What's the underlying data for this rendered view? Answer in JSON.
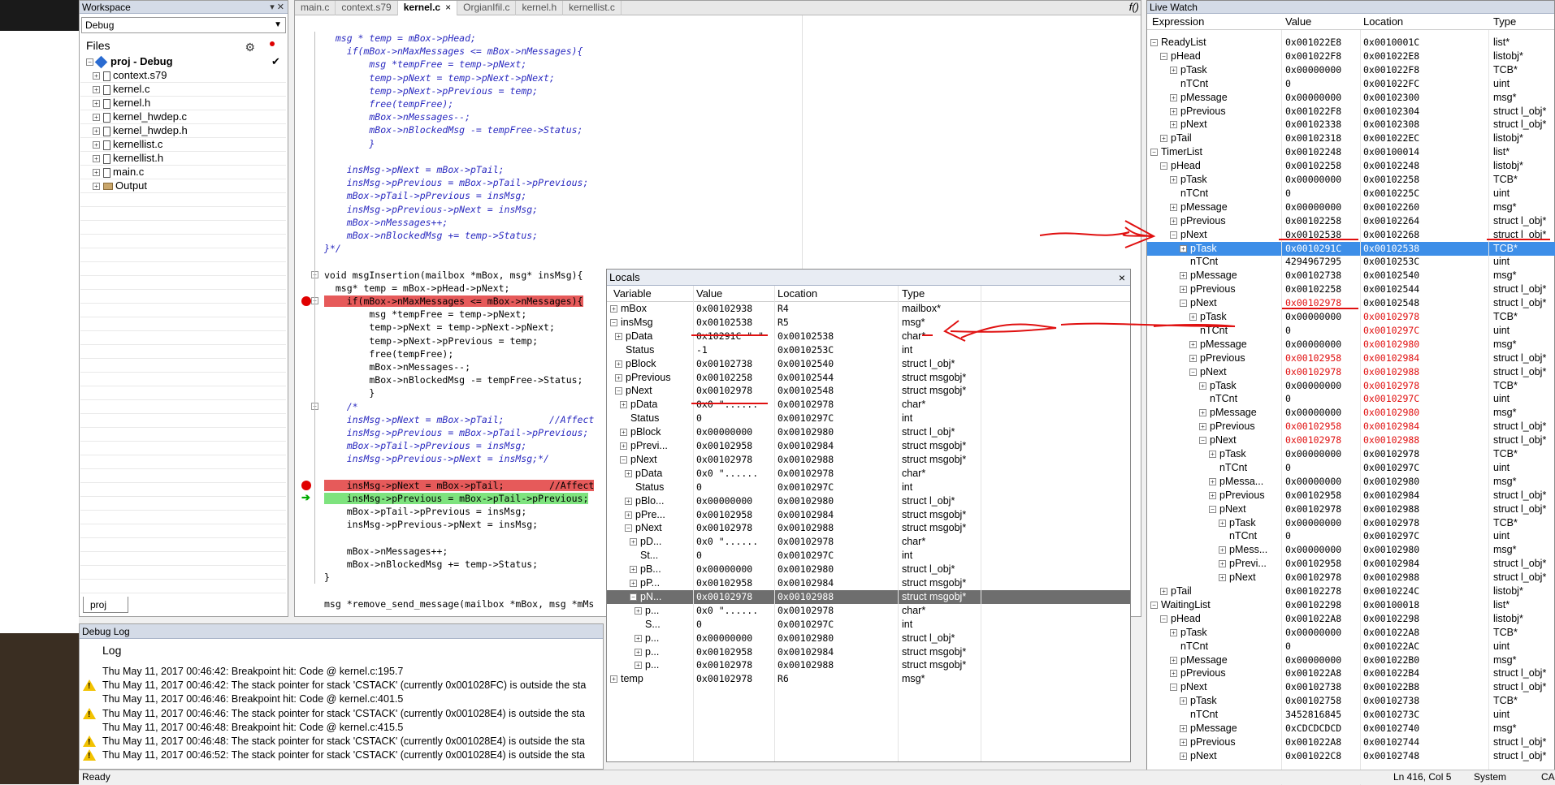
{
  "workspace": {
    "title": "Workspace",
    "config": "Debug",
    "files_label": "Files",
    "project": "proj - Debug",
    "files": [
      {
        "name": "context.s79",
        "expand": "+"
      },
      {
        "name": "kernel.c",
        "expand": "+"
      },
      {
        "name": "kernel.h",
        "expand": "+"
      },
      {
        "name": "kernel_hwdep.c",
        "expand": "+"
      },
      {
        "name": "kernel_hwdep.h",
        "expand": "+"
      },
      {
        "name": "kernellist.c",
        "expand": "+"
      },
      {
        "name": "kernellist.h",
        "expand": "+"
      },
      {
        "name": "main.c",
        "expand": "+"
      },
      {
        "name": "Output",
        "expand": "+"
      }
    ],
    "tab": "proj"
  },
  "editor": {
    "tabs": [
      "main.c",
      "context.s79",
      "kernel.c",
      "OrgianIfil.c",
      "kernel.h",
      "kernellist.c"
    ],
    "active_tab": "kernel.c",
    "tab_close": "×",
    "fx": "f()",
    "lines": [
      {
        "t": "  msg * temp = mBox->pHead;",
        "c": "cm"
      },
      {
        "t": "    if(mBox->nMaxMessages <= mBox->nMessages){",
        "c": "cm"
      },
      {
        "t": "        msg *tempFree = temp->pNext;",
        "c": "cm"
      },
      {
        "t": "        temp->pNext = temp->pNext->pNext;",
        "c": "cm"
      },
      {
        "t": "        temp->pNext->pPrevious = temp;",
        "c": "cm"
      },
      {
        "t": "        free(tempFree);",
        "c": "cm"
      },
      {
        "t": "        mBox->nMessages--;",
        "c": "cm"
      },
      {
        "t": "        mBox->nBlockedMsg -= tempFree->Status;",
        "c": "cm"
      },
      {
        "t": "        }",
        "c": "cm"
      },
      {
        "t": "",
        "c": ""
      },
      {
        "t": "    insMsg->pNext = mBox->pTail;",
        "c": "cm"
      },
      {
        "t": "    insMsg->pPrevious = mBox->pTail->pPrevious;",
        "c": "cm"
      },
      {
        "t": "    mBox->pTail->pPrevious = insMsg;",
        "c": "cm"
      },
      {
        "t": "    insMsg->pPrevious->pNext = insMsg;",
        "c": "cm"
      },
      {
        "t": "    mBox->nMessages++;",
        "c": "cm"
      },
      {
        "t": "    mBox->nBlockedMsg += temp->Status;",
        "c": "cm"
      },
      {
        "t": "}*/",
        "c": "cm"
      },
      {
        "t": "",
        "c": ""
      },
      {
        "t": "void msgInsertion(mailbox *mBox, msg* insMsg){",
        "c": ""
      },
      {
        "t": "  msg* temp = mBox->pHead->pNext;",
        "c": ""
      },
      {
        "t": "    if(mBox->nMaxMessages <= mBox->nMessages){",
        "c": "",
        "hl": "red"
      },
      {
        "t": "        msg *tempFree = temp->pNext;",
        "c": ""
      },
      {
        "t": "        temp->pNext = temp->pNext->pNext;",
        "c": ""
      },
      {
        "t": "        temp->pNext->pPrevious = temp;",
        "c": ""
      },
      {
        "t": "        free(tempFree);",
        "c": ""
      },
      {
        "t": "        mBox->nMessages--;",
        "c": ""
      },
      {
        "t": "        mBox->nBlockedMsg -= tempFree->Status;",
        "c": ""
      },
      {
        "t": "        }",
        "c": ""
      },
      {
        "t": "    /*",
        "c": "cm"
      },
      {
        "t": "    insMsg->pNext = mBox->pTail;        //Affect",
        "c": "cm"
      },
      {
        "t": "    insMsg->pPrevious = mBox->pTail->pPrevious;",
        "c": "cm"
      },
      {
        "t": "    mBox->pTail->pPrevious = insMsg;",
        "c": "cm"
      },
      {
        "t": "    insMsg->pPrevious->pNext = insMsg;*/",
        "c": "cm"
      },
      {
        "t": "",
        "c": ""
      },
      {
        "t": "    insMsg->pNext = mBox->pTail;        //Affect",
        "c": "",
        "hl": "red"
      },
      {
        "t": "    insMsg->pPrevious = mBox->pTail->pPrevious;",
        "c": "",
        "hl": "green"
      },
      {
        "t": "    mBox->pTail->pPrevious = insMsg;",
        "c": ""
      },
      {
        "t": "    insMsg->pPrevious->pNext = insMsg;",
        "c": ""
      },
      {
        "t": "",
        "c": ""
      },
      {
        "t": "    mBox->nMessages++;",
        "c": ""
      },
      {
        "t": "    mBox->nBlockedMsg += temp->Status;",
        "c": ""
      },
      {
        "t": "}",
        "c": ""
      },
      {
        "t": "",
        "c": ""
      },
      {
        "t": "msg *remove_send_message(mailbox *mBox, msg *mMs",
        "c": ""
      }
    ]
  },
  "locals": {
    "title": "Locals",
    "close": "×",
    "columns": [
      "Variable",
      "Value",
      "Location",
      "Type"
    ],
    "rows": [
      {
        "d": 0,
        "e": "+",
        "n": "mBox",
        "v": "0x00102938",
        "l": "R4",
        "t": "mailbox*"
      },
      {
        "d": 0,
        "e": "−",
        "n": "insMsg",
        "v": "0x00102538",
        "l": "R5",
        "t": "msg*"
      },
      {
        "d": 1,
        "e": "+",
        "n": "pData",
        "v": "0x10291C \" \"",
        "l": "0x00102538",
        "t": "char*"
      },
      {
        "d": 1,
        "e": "",
        "n": "Status",
        "v": "-1",
        "l": "0x0010253C",
        "t": "int"
      },
      {
        "d": 1,
        "e": "+",
        "n": "pBlock",
        "v": "0x00102738",
        "l": "0x00102540",
        "t": "struct l_obj*"
      },
      {
        "d": 1,
        "e": "+",
        "n": "pPrevious",
        "v": "0x00102258",
        "l": "0x00102544",
        "t": "struct msgobj*"
      },
      {
        "d": 1,
        "e": "−",
        "n": "pNext",
        "v": "0x00102978",
        "l": "0x00102548",
        "t": "struct msgobj*"
      },
      {
        "d": 2,
        "e": "+",
        "n": "pData",
        "v": "0x0 \"......",
        "l": "0x00102978",
        "t": "char*"
      },
      {
        "d": 2,
        "e": "",
        "n": "Status",
        "v": "0",
        "l": "0x0010297C",
        "t": "int"
      },
      {
        "d": 2,
        "e": "+",
        "n": "pBlock",
        "v": "0x00000000",
        "l": "0x00102980",
        "t": "struct l_obj*"
      },
      {
        "d": 2,
        "e": "+",
        "n": "pPrevi...",
        "v": "0x00102958",
        "l": "0x00102984",
        "t": "struct msgobj*"
      },
      {
        "d": 2,
        "e": "−",
        "n": "pNext",
        "v": "0x00102978",
        "l": "0x00102988",
        "t": "struct msgobj*"
      },
      {
        "d": 3,
        "e": "+",
        "n": "pData",
        "v": "0x0 \"......",
        "l": "0x00102978",
        "t": "char*"
      },
      {
        "d": 3,
        "e": "",
        "n": "Status",
        "v": "0",
        "l": "0x0010297C",
        "t": "int"
      },
      {
        "d": 3,
        "e": "+",
        "n": "pBlo...",
        "v": "0x00000000",
        "l": "0x00102980",
        "t": "struct l_obj*"
      },
      {
        "d": 3,
        "e": "+",
        "n": "pPre...",
        "v": "0x00102958",
        "l": "0x00102984",
        "t": "struct msgobj*"
      },
      {
        "d": 3,
        "e": "−",
        "n": "pNext",
        "v": "0x00102978",
        "l": "0x00102988",
        "t": "struct msgobj*"
      },
      {
        "d": 4,
        "e": "+",
        "n": "pD...",
        "v": "0x0 \"......",
        "l": "0x00102978",
        "t": "char*"
      },
      {
        "d": 4,
        "e": "",
        "n": "St...",
        "v": "0",
        "l": "0x0010297C",
        "t": "int"
      },
      {
        "d": 4,
        "e": "+",
        "n": "pB...",
        "v": "0x00000000",
        "l": "0x00102980",
        "t": "struct l_obj*"
      },
      {
        "d": 4,
        "e": "+",
        "n": "pP...",
        "v": "0x00102958",
        "l": "0x00102984",
        "t": "struct msgobj*"
      },
      {
        "d": 4,
        "e": "−",
        "n": "pN...",
        "v": "0x00102978",
        "l": "0x00102988",
        "t": "struct msgobj*",
        "sel": true
      },
      {
        "d": 5,
        "e": "+",
        "n": "p...",
        "v": "0x0 \"......",
        "l": "0x00102978",
        "t": "char*"
      },
      {
        "d": 5,
        "e": "",
        "n": "S...",
        "v": "0",
        "l": "0x0010297C",
        "t": "int"
      },
      {
        "d": 5,
        "e": "+",
        "n": "p...",
        "v": "0x00000000",
        "l": "0x00102980",
        "t": "struct l_obj*"
      },
      {
        "d": 5,
        "e": "+",
        "n": "p...",
        "v": "0x00102958",
        "l": "0x00102984",
        "t": "struct msgobj*"
      },
      {
        "d": 5,
        "e": "+",
        "n": "p...",
        "v": "0x00102978",
        "l": "0x00102988",
        "t": "struct msgobj*"
      },
      {
        "d": 0,
        "e": "+",
        "n": "temp",
        "v": "0x00102978",
        "l": "R6",
        "t": "msg*"
      }
    ]
  },
  "live_watch": {
    "title": "Live Watch",
    "columns": [
      "Expression",
      "Value",
      "Location",
      "Type"
    ],
    "rows": [
      {
        "d": 0,
        "e": "−",
        "n": "ReadyList",
        "v": "0x001022E8",
        "l": "0x0010001C",
        "t": "list*"
      },
      {
        "d": 1,
        "e": "−",
        "n": "pHead",
        "v": "0x001022F8",
        "l": "0x001022E8",
        "t": "listobj*"
      },
      {
        "d": 2,
        "e": "+",
        "n": "pTask",
        "v": "0x00000000",
        "l": "0x001022F8",
        "t": "TCB*"
      },
      {
        "d": 2,
        "e": "",
        "n": "nTCnt",
        "v": "0",
        "l": "0x001022FC",
        "t": "uint"
      },
      {
        "d": 2,
        "e": "+",
        "n": "pMessage",
        "v": "0x00000000",
        "l": "0x00102300",
        "t": "msg*"
      },
      {
        "d": 2,
        "e": "+",
        "n": "pPrevious",
        "v": "0x001022F8",
        "l": "0x00102304",
        "t": "struct l_obj*"
      },
      {
        "d": 2,
        "e": "+",
        "n": "pNext",
        "v": "0x00102338",
        "l": "0x00102308",
        "t": "struct l_obj*"
      },
      {
        "d": 1,
        "e": "+",
        "n": "pTail",
        "v": "0x00102318",
        "l": "0x001022EC",
        "t": "listobj*"
      },
      {
        "d": 0,
        "e": "−",
        "n": "TimerList",
        "v": "0x00102248",
        "l": "0x00100014",
        "t": "list*"
      },
      {
        "d": 1,
        "e": "−",
        "n": "pHead",
        "v": "0x00102258",
        "l": "0x00102248",
        "t": "listobj*"
      },
      {
        "d": 2,
        "e": "+",
        "n": "pTask",
        "v": "0x00000000",
        "l": "0x00102258",
        "t": "TCB*"
      },
      {
        "d": 2,
        "e": "",
        "n": "nTCnt",
        "v": "0",
        "l": "0x0010225C",
        "t": "uint"
      },
      {
        "d": 2,
        "e": "+",
        "n": "pMessage",
        "v": "0x00000000",
        "l": "0x00102260",
        "t": "msg*"
      },
      {
        "d": 2,
        "e": "+",
        "n": "pPrevious",
        "v": "0x00102258",
        "l": "0x00102264",
        "t": "struct l_obj*"
      },
      {
        "d": 2,
        "e": "−",
        "n": "pNext",
        "v": "0x00102538",
        "l": "0x00102268",
        "t": "struct l_obj*"
      },
      {
        "d": 3,
        "e": "+",
        "n": "pTask",
        "v": "0x0010291C",
        "l": "0x00102538",
        "t": "TCB*",
        "sel": true
      },
      {
        "d": 3,
        "e": "",
        "n": "nTCnt",
        "v": "4294967295",
        "l": "0x0010253C",
        "t": "uint"
      },
      {
        "d": 3,
        "e": "+",
        "n": "pMessage",
        "v": "0x00102738",
        "l": "0x00102540",
        "t": "msg*"
      },
      {
        "d": 3,
        "e": "+",
        "n": "pPrevious",
        "v": "0x00102258",
        "l": "0x00102544",
        "t": "struct l_obj*"
      },
      {
        "d": 3,
        "e": "−",
        "n": "pNext",
        "v": "0x00102978",
        "l": "0x00102548",
        "t": "struct l_obj*",
        "rv": true
      },
      {
        "d": 4,
        "e": "+",
        "n": "pTask",
        "v": "0x00000000",
        "l": "0x00102978",
        "t": "TCB*",
        "rl": true
      },
      {
        "d": 4,
        "e": "",
        "n": "nTCnt",
        "v": "0",
        "l": "0x0010297C",
        "t": "uint",
        "rl": true
      },
      {
        "d": 4,
        "e": "+",
        "n": "pMessage",
        "v": "0x00000000",
        "l": "0x00102980",
        "t": "msg*",
        "rl": true
      },
      {
        "d": 4,
        "e": "+",
        "n": "pPrevious",
        "v": "0x00102958",
        "l": "0x00102984",
        "t": "struct l_obj*",
        "rv": true,
        "rl": true
      },
      {
        "d": 4,
        "e": "−",
        "n": "pNext",
        "v": "0x00102978",
        "l": "0x00102988",
        "t": "struct l_obj*",
        "rv": true,
        "rl": true
      },
      {
        "d": 5,
        "e": "+",
        "n": "pTask",
        "v": "0x00000000",
        "l": "0x00102978",
        "t": "TCB*",
        "rl": true
      },
      {
        "d": 5,
        "e": "",
        "n": "nTCnt",
        "v": "0",
        "l": "0x0010297C",
        "t": "uint",
        "rl": true
      },
      {
        "d": 5,
        "e": "+",
        "n": "pMessage",
        "v": "0x00000000",
        "l": "0x00102980",
        "t": "msg*",
        "rl": true
      },
      {
        "d": 5,
        "e": "+",
        "n": "pPrevious",
        "v": "0x00102958",
        "l": "0x00102984",
        "t": "struct l_obj*",
        "rv": true,
        "rl": true
      },
      {
        "d": 5,
        "e": "−",
        "n": "pNext",
        "v": "0x00102978",
        "l": "0x00102988",
        "t": "struct l_obj*",
        "rv": true,
        "rl": true
      },
      {
        "d": 6,
        "e": "+",
        "n": "pTask",
        "v": "0x00000000",
        "l": "0x00102978",
        "t": "TCB*"
      },
      {
        "d": 6,
        "e": "",
        "n": "nTCnt",
        "v": "0",
        "l": "0x0010297C",
        "t": "uint"
      },
      {
        "d": 6,
        "e": "+",
        "n": "pMessa...",
        "v": "0x00000000",
        "l": "0x00102980",
        "t": "msg*"
      },
      {
        "d": 6,
        "e": "+",
        "n": "pPrevious",
        "v": "0x00102958",
        "l": "0x00102984",
        "t": "struct l_obj*"
      },
      {
        "d": 6,
        "e": "−",
        "n": "pNext",
        "v": "0x00102978",
        "l": "0x00102988",
        "t": "struct l_obj*"
      },
      {
        "d": 7,
        "e": "+",
        "n": "pTask",
        "v": "0x00000000",
        "l": "0x00102978",
        "t": "TCB*"
      },
      {
        "d": 7,
        "e": "",
        "n": "nTCnt",
        "v": "0",
        "l": "0x0010297C",
        "t": "uint"
      },
      {
        "d": 7,
        "e": "+",
        "n": "pMess...",
        "v": "0x00000000",
        "l": "0x00102980",
        "t": "msg*"
      },
      {
        "d": 7,
        "e": "+",
        "n": "pPrevi...",
        "v": "0x00102958",
        "l": "0x00102984",
        "t": "struct l_obj*"
      },
      {
        "d": 7,
        "e": "+",
        "n": "pNext",
        "v": "0x00102978",
        "l": "0x00102988",
        "t": "struct l_obj*"
      },
      {
        "d": 1,
        "e": "+",
        "n": "pTail",
        "v": "0x00102278",
        "l": "0x0010224C",
        "t": "listobj*"
      },
      {
        "d": 0,
        "e": "−",
        "n": "WaitingList",
        "v": "0x00102298",
        "l": "0x00100018",
        "t": "list*"
      },
      {
        "d": 1,
        "e": "−",
        "n": "pHead",
        "v": "0x001022A8",
        "l": "0x00102298",
        "t": "listobj*"
      },
      {
        "d": 2,
        "e": "+",
        "n": "pTask",
        "v": "0x00000000",
        "l": "0x001022A8",
        "t": "TCB*"
      },
      {
        "d": 2,
        "e": "",
        "n": "nTCnt",
        "v": "0",
        "l": "0x001022AC",
        "t": "uint"
      },
      {
        "d": 2,
        "e": "+",
        "n": "pMessage",
        "v": "0x00000000",
        "l": "0x001022B0",
        "t": "msg*"
      },
      {
        "d": 2,
        "e": "+",
        "n": "pPrevious",
        "v": "0x001022A8",
        "l": "0x001022B4",
        "t": "struct l_obj*"
      },
      {
        "d": 2,
        "e": "−",
        "n": "pNext",
        "v": "0x00102738",
        "l": "0x001022B8",
        "t": "struct l_obj*"
      },
      {
        "d": 3,
        "e": "+",
        "n": "pTask",
        "v": "0x00102758",
        "l": "0x00102738",
        "t": "TCB*"
      },
      {
        "d": 3,
        "e": "",
        "n": "nTCnt",
        "v": "3452816845",
        "l": "0x0010273C",
        "t": "uint"
      },
      {
        "d": 3,
        "e": "+",
        "n": "pMessage",
        "v": "0xCDCDCDCD",
        "l": "0x00102740",
        "t": "msg*"
      },
      {
        "d": 3,
        "e": "+",
        "n": "pPrevious",
        "v": "0x001022A8",
        "l": "0x00102744",
        "t": "struct l_obj*"
      },
      {
        "d": 3,
        "e": "+",
        "n": "pNext",
        "v": "0x001022C8",
        "l": "0x00102748",
        "t": "struct l_obj*"
      }
    ]
  },
  "debug_log": {
    "title": "Debug Log",
    "header": "Log",
    "lines": [
      {
        "warn": false,
        "text": "Thu May 11, 2017 00:46:42: Breakpoint hit: Code @ kernel.c:195.7"
      },
      {
        "warn": true,
        "text": "Thu May 11, 2017 00:46:42: The stack pointer for stack 'CSTACK' (currently 0x001028FC) is outside the sta"
      },
      {
        "warn": false,
        "text": "Thu May 11, 2017 00:46:46: Breakpoint hit: Code @ kernel.c:401.5"
      },
      {
        "warn": true,
        "text": "Thu May 11, 2017 00:46:46: The stack pointer for stack 'CSTACK' (currently 0x001028E4) is outside the sta"
      },
      {
        "warn": false,
        "text": "Thu May 11, 2017 00:46:48: Breakpoint hit: Code @ kernel.c:415.5"
      },
      {
        "warn": true,
        "text": "Thu May 11, 2017 00:46:48: The stack pointer for stack 'CSTACK' (currently 0x001028E4) is outside the sta"
      },
      {
        "warn": true,
        "text": "Thu May 11, 2017 00:46:52: The stack pointer for stack 'CSTACK' (currently 0x001028E4) is outside the sta"
      }
    ]
  },
  "status": {
    "ready": "Ready",
    "position": "Ln 416, Col 5",
    "system": "System",
    "cap": "CAP"
  },
  "colors": {
    "breakpoint": "#e00000",
    "highlight_red": "#e65a5a",
    "highlight_green": "#7ee37e",
    "selection_blue": "#3d8ee8",
    "changed_value": "#e01010"
  }
}
